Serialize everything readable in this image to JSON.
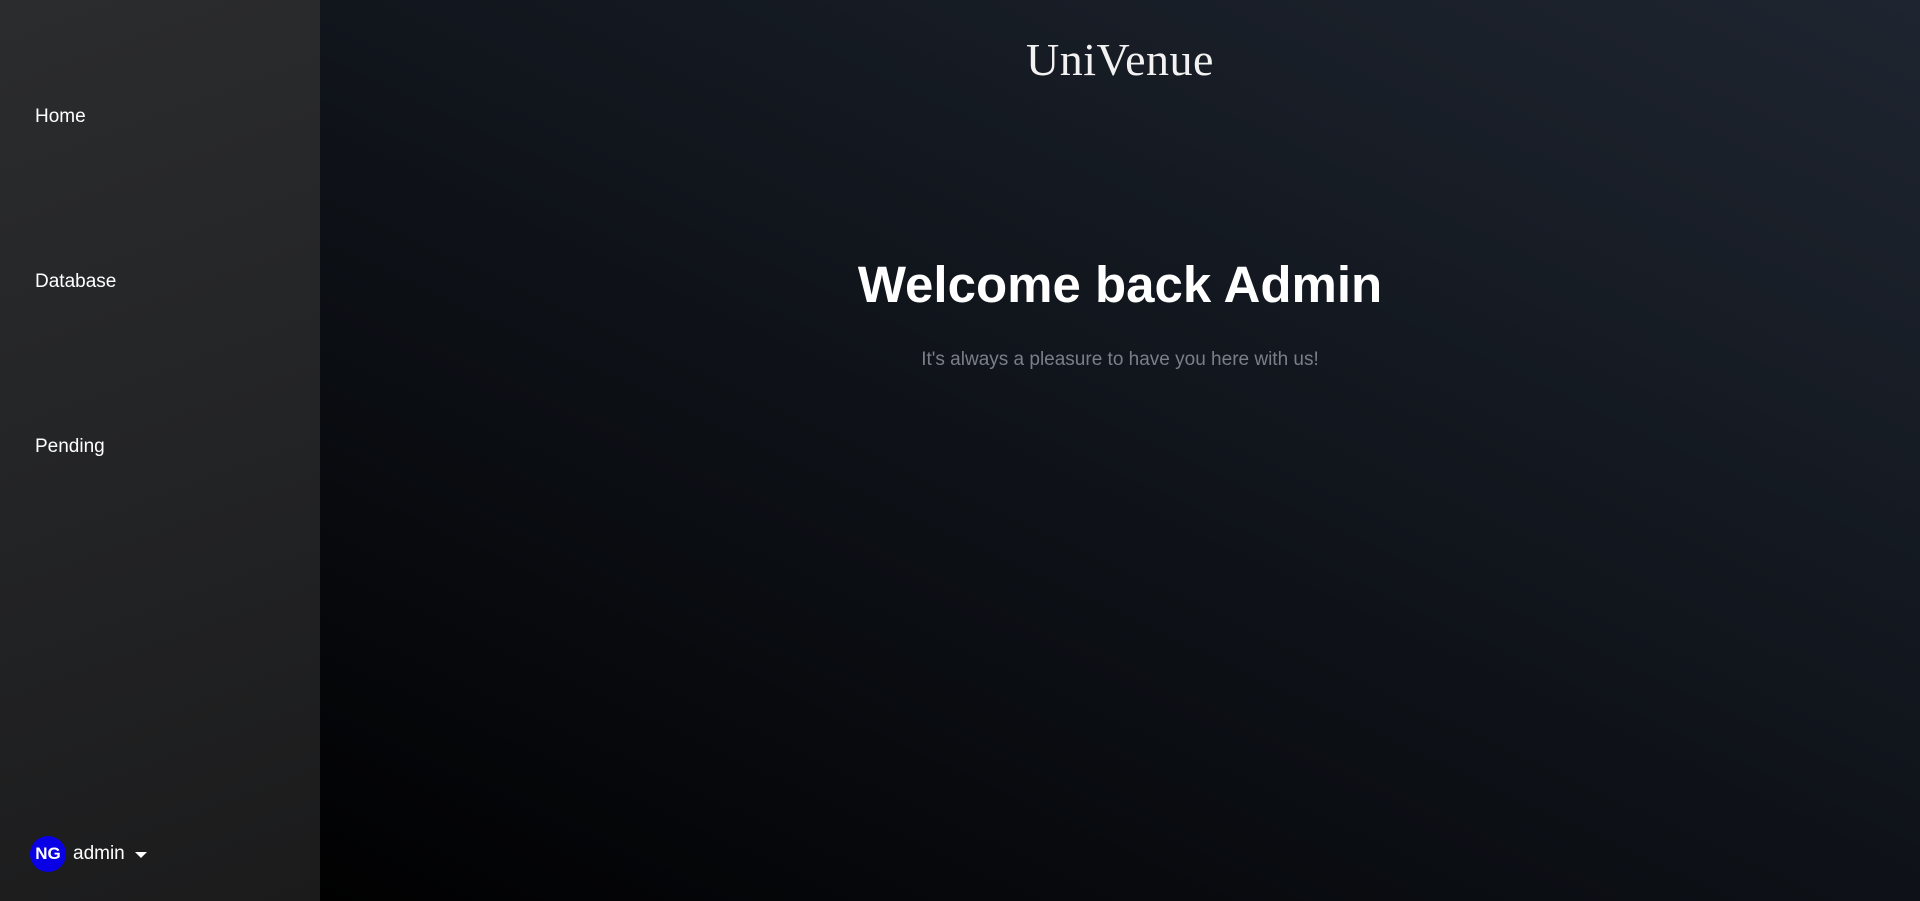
{
  "sidebar": {
    "items": [
      {
        "label": "Home"
      },
      {
        "label": "Database"
      },
      {
        "label": "Pending"
      }
    ],
    "user": {
      "initials": "NG",
      "name": "admin",
      "avatar_color": "#0a00e6",
      "menu_icon": "caret-down-icon"
    }
  },
  "main": {
    "brand": "UniVenue",
    "heading": "Welcome back Admin",
    "subheading": "It's always a pleasure to have you here with us!"
  },
  "colors": {
    "sidebar_bg": "#262729",
    "main_bg_top": "#1f2530",
    "main_bg_bottom": "#010102",
    "subtitle_text": "#7a7f88"
  }
}
